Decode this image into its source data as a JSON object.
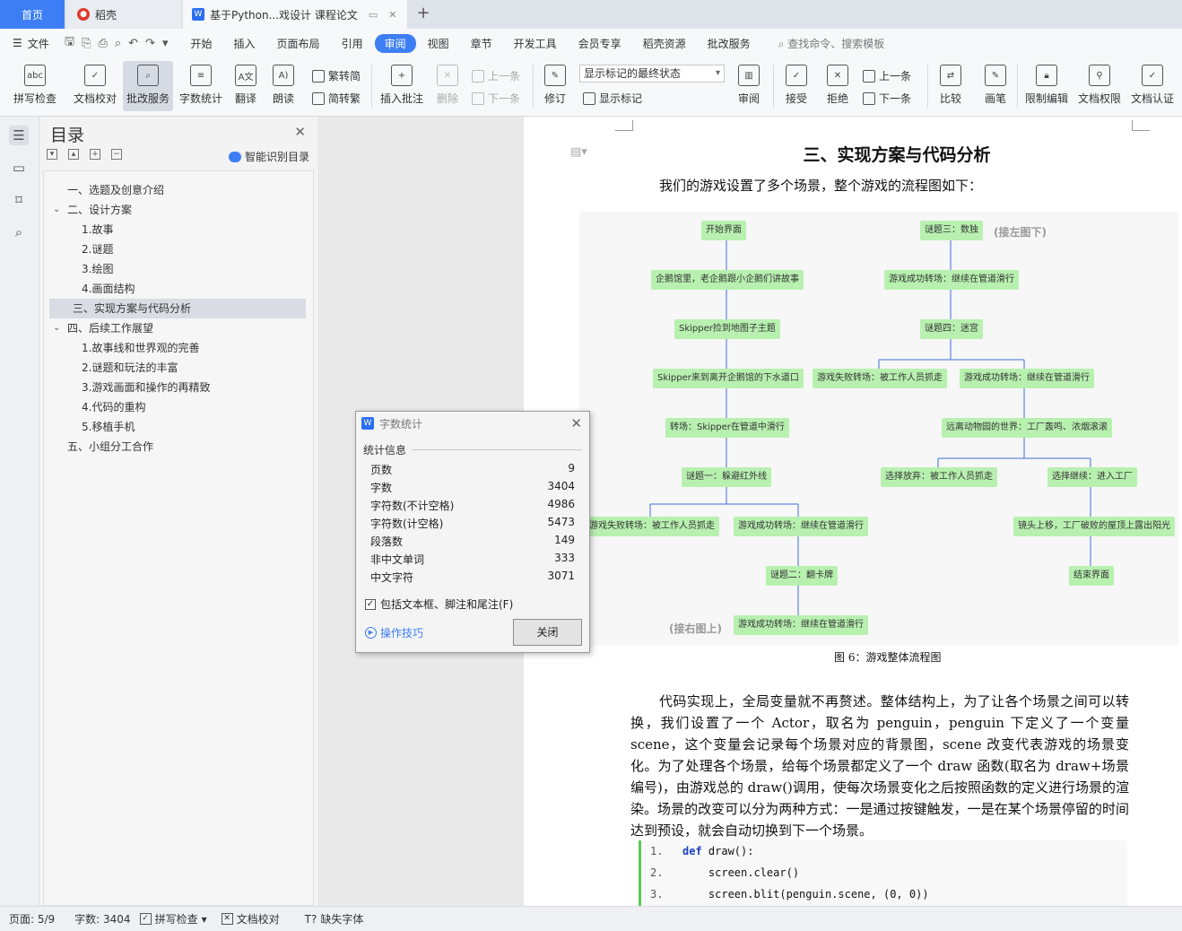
{
  "tabs": {
    "home": "首页",
    "daoke": "稻壳",
    "doc": "基于Python...戏设计 课程论文"
  },
  "menubar": {
    "file": "文件",
    "items": [
      "开始",
      "插入",
      "页面布局",
      "引用",
      "审阅",
      "视图",
      "章节",
      "开发工具",
      "会员专享",
      "稻壳资源",
      "批改服务"
    ],
    "active": "审阅",
    "search": "查找命令、搜索模板"
  },
  "ribbon": {
    "spellcheck": "拼写检查",
    "doccheck": "文档校对",
    "correct": "批改服务",
    "wordcount": "字数统计",
    "translate": "翻译",
    "read": "朗读",
    "to_trad": "繁转简",
    "to_simp": "简转繁",
    "insert_comment": "插入批注",
    "delete": "删除",
    "prev": "上一条",
    "next": "下一条",
    "revise": "修订",
    "markup_state": "显示标记的最终状态",
    "show_markup": "显示标记",
    "review": "审阅",
    "accept": "接受",
    "reject": "拒绝",
    "prev2": "上一条",
    "next2": "下一条",
    "compare": "比较",
    "pen": "画笔",
    "restrict": "限制编辑",
    "permission": "文档权限",
    "certify": "文档认证"
  },
  "outline": {
    "title": "目录",
    "smart": "智能识别目录",
    "items": [
      {
        "text": "一、选题及创意介绍",
        "level": 1
      },
      {
        "text": "二、设计方案",
        "level": 1
      },
      {
        "text": "1.故事",
        "level": 2
      },
      {
        "text": "2.谜题",
        "level": 2
      },
      {
        "text": "3.绘图",
        "level": 2
      },
      {
        "text": "4.画面结构",
        "level": 2
      },
      {
        "text": "三、实现方案与代码分析",
        "level": 1
      },
      {
        "text": "四、后续工作展望",
        "level": 1
      },
      {
        "text": "1.故事线和世界观的完善",
        "level": 2
      },
      {
        "text": "2.谜题和玩法的丰富",
        "level": 2
      },
      {
        "text": "3.游戏画面和操作的再精致",
        "level": 2
      },
      {
        "text": "4.代码的重构",
        "level": 2
      },
      {
        "text": "5.移植手机",
        "level": 2
      },
      {
        "text": "五、小组分工合作",
        "level": 1
      }
    ]
  },
  "doc": {
    "heading": "三、实现方案与代码分析",
    "intro": "我们的游戏设置了多个场景，整个游戏的流程图如下：",
    "caption": "图 6：游戏整体流程图",
    "body": "代码实现上，全局变量就不再赘述。整体结构上，为了让各个场景之间可以转换，我们设置了一个 Actor，取名为 penguin，penguin 下定义了一个变量 scene，这个变量会记录每个场景对应的背景图，scene 改变代表游戏的场景变化。为了处理各个场景，给每个场景都定义了一个 draw 函数(取名为 draw+场景编号)，由游戏总的 draw()调用，使每次场景变化之后按照函数的定义进行场景的渲染。场景的改变可以分为两种方式：一是通过按键触发，一是在某个场景停留的时间达到预设，就会自动切换到下一个场景。",
    "code": [
      {
        "n": "1.",
        "pre": "",
        "kw": "def",
        "rest": " draw():"
      },
      {
        "n": "2.",
        "pre": "    ",
        "kw": "",
        "rest": "screen.clear()"
      },
      {
        "n": "3.",
        "pre": "    ",
        "kw": "",
        "rest": "screen.blit(penguin.scene, (0, 0))"
      }
    ]
  },
  "flow": {
    "nodes": {
      "start": "开始界面",
      "n1": "企鹅馆里，老企鹅跟小企鹅们讲故事",
      "n2": "Skipper捡到地图子主题",
      "n3": "Skipper来到离开企鹅馆的下水道口",
      "n4": "转场：Skipper在管道中滑行",
      "p1": "谜题一：躲避红外线",
      "f1": "游戏失败转场：被工作人员抓走",
      "s1": "游戏成功转场：继续在管道滑行",
      "p2": "谜题二：翻卡牌",
      "s2": "游戏成功转场：继续在管道滑行",
      "p3": "谜题三：数独",
      "s3": "游戏成功转场：继续在管道滑行",
      "p4": "谜题四：迷宫",
      "f4": "游戏失败转场：被工作人员抓走",
      "s4": "游戏成功转场：继续在管道滑行",
      "zoo": "远离动物园的世界：工厂轰鸣、浓烟滚滚",
      "give": "选择放弃：被工作人员抓走",
      "cont": "选择继续：进入工厂",
      "up": "镜头上移，工厂破败的屋顶上露出阳光",
      "end": "结束界面"
    },
    "note_right": "(接右图上)",
    "note_left": "(接左图下)"
  },
  "dialog": {
    "title": "字数统计",
    "group": "统计信息",
    "rows": [
      {
        "label": "页数",
        "value": "9"
      },
      {
        "label": "字数",
        "value": "3404"
      },
      {
        "label": "字符数(不计空格)",
        "value": "4986"
      },
      {
        "label": "字符数(计空格)",
        "value": "5473"
      },
      {
        "label": "段落数",
        "value": "149"
      },
      {
        "label": "非中文单词",
        "value": "333"
      },
      {
        "label": "中文字符",
        "value": "3071"
      }
    ],
    "checkbox": "包括文本框、脚注和尾注(F)",
    "tips": "操作技巧",
    "close": "关闭"
  },
  "status": {
    "page": "页面: 5/9",
    "words": "字数: 3404",
    "spell": "拼写检查",
    "proof": "文档校对",
    "missing_font": "缺失字体"
  }
}
